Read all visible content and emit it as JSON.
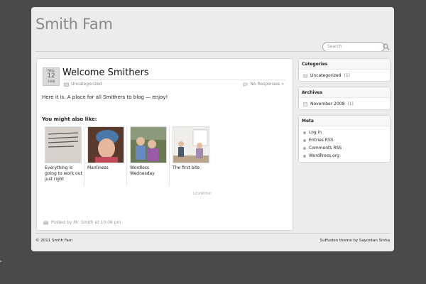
{
  "site": {
    "title": "Smith Fam"
  },
  "search": {
    "placeholder": "Search"
  },
  "post": {
    "date_month": "Nov",
    "date_day": "12",
    "date_year": "2008",
    "title": "Welcome Smithers",
    "category": "Uncategorized",
    "responses": "No Responses »",
    "body": "Here it is.  A place for all Smithers to blog — enjoy!",
    "related_heading": "You might also like:",
    "related": [
      {
        "label": "Everything is going to work out just right",
        "icon": "quote-image"
      },
      {
        "label": "Manliness",
        "icon": "child-photo"
      },
      {
        "label": "Wordless Wednesday",
        "icon": "kids-photo"
      },
      {
        "label": "The first bite.",
        "icon": "room-photo"
      }
    ],
    "linkwithin": "LinkWithin",
    "posted_by": "Posted by Mr. Smith at 10:06 pm"
  },
  "sidebar": {
    "categories": {
      "title": "Categories",
      "items": [
        {
          "label": "Uncategorized",
          "count": "(1)"
        }
      ]
    },
    "archives": {
      "title": "Archives",
      "items": [
        {
          "label": "November 2008",
          "count": "(1)"
        }
      ]
    },
    "meta": {
      "title": "Meta",
      "items": [
        {
          "label": "Log in"
        },
        {
          "label": "Entries RSS"
        },
        {
          "label": "Comments RSS"
        },
        {
          "label": "WordPress.org"
        }
      ]
    }
  },
  "footer": {
    "copyright": "© 2011 Smith Fam",
    "credit": "Suffusion theme by Sayontan Sinha"
  },
  "colors": {
    "background": "#4a4a4a",
    "page": "#ececec",
    "accent": "#888888"
  }
}
